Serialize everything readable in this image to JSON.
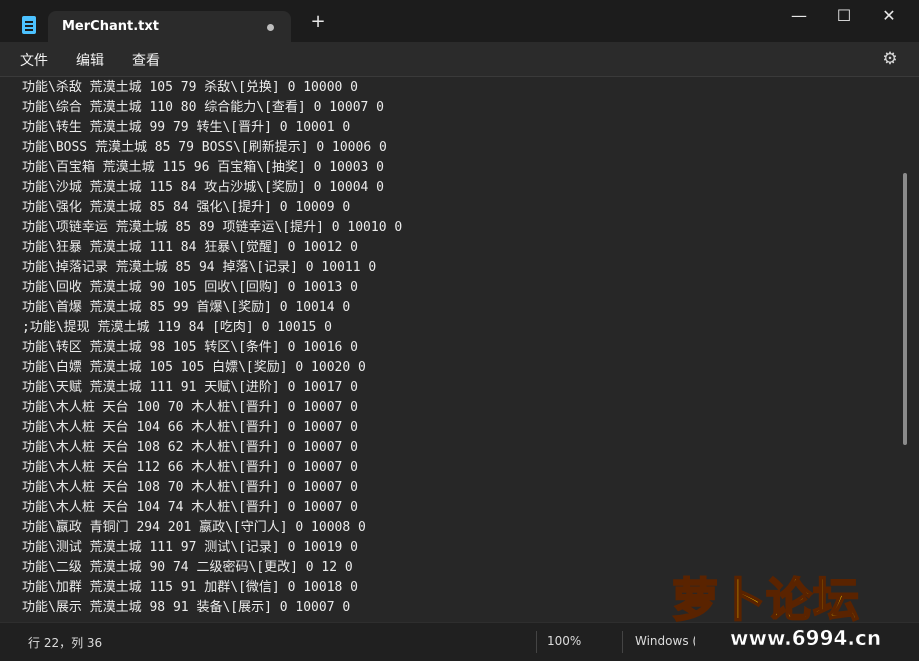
{
  "titlebar": {
    "tab_title": "MerChant.txt",
    "new_tab": "+",
    "minimize": "—",
    "maximize": "☐",
    "close": "✕"
  },
  "menu": {
    "file": "文件",
    "edit": "编辑",
    "view": "查看",
    "settings_icon": "⚙"
  },
  "editor": {
    "lines": [
      "功能\\杀敌 荒漠土城 105 79 杀敌\\[兑换] 0 10000 0",
      "功能\\综合 荒漠土城 110 80 综合能力\\[查看] 0 10007 0",
      "功能\\转生 荒漠土城 99 79 转生\\[晋升] 0 10001 0",
      "功能\\BOSS 荒漠土城 85 79 BOSS\\[刷新提示] 0 10006 0",
      "功能\\百宝箱 荒漠土城 115 96 百宝箱\\[抽奖] 0 10003 0",
      "功能\\沙城 荒漠土城 115 84 攻占沙城\\[奖励] 0 10004 0",
      "功能\\强化 荒漠土城 85 84 强化\\[提升] 0 10009 0",
      "功能\\项链幸运 荒漠土城 85 89 项链幸运\\[提升] 0 10010 0",
      "功能\\狂暴 荒漠土城 111 84 狂暴\\[觉醒] 0 10012 0",
      "功能\\掉落记录 荒漠土城 85 94 掉落\\[记录] 0 10011 0",
      "功能\\回收 荒漠土城 90 105 回收\\[回购] 0 10013 0",
      "功能\\首爆 荒漠土城 85 99 首爆\\[奖励] 0 10014 0",
      ";功能\\提现 荒漠土城 119 84 [吃肉] 0 10015 0",
      "功能\\转区 荒漠土城 98 105 转区\\[条件] 0 10016 0",
      "功能\\白嫖 荒漠土城 105 105 白嫖\\[奖励] 0 10020 0",
      "功能\\天赋 荒漠土城 111 91 天赋\\[进阶] 0 10017 0",
      "功能\\木人桩 天台 100 70 木人桩\\[晋升] 0 10007 0",
      "功能\\木人桩 天台 104 66 木人桩\\[晋升] 0 10007 0",
      "功能\\木人桩 天台 108 62 木人桩\\[晋升] 0 10007 0",
      "功能\\木人桩 天台 112 66 木人桩\\[晋升] 0 10007 0",
      "功能\\木人桩 天台 108 70 木人桩\\[晋升] 0 10007 0",
      "功能\\木人桩 天台 104 74 木人桩\\[晋升] 0 10007 0",
      "功能\\嬴政 青铜门 294 201 嬴政\\[守门人] 0 10008 0",
      "功能\\测试 荒漠土城 111 97 测试\\[记录] 0 10019 0",
      "功能\\二级 荒漠土城 90 74 二级密码\\[更改] 0 12 0",
      "功能\\加群 荒漠土城 115 91 加群\\[微信] 0 10018 0",
      "功能\\展示 荒漠土城 98 91 装备\\[展示] 0 10007 0"
    ]
  },
  "status": {
    "position": "行 22，列 36",
    "zoom": "100%",
    "line_ending": "Windows (C"
  },
  "watermark": {
    "main": "萝卜论坛",
    "url": "www.6994.cn"
  }
}
